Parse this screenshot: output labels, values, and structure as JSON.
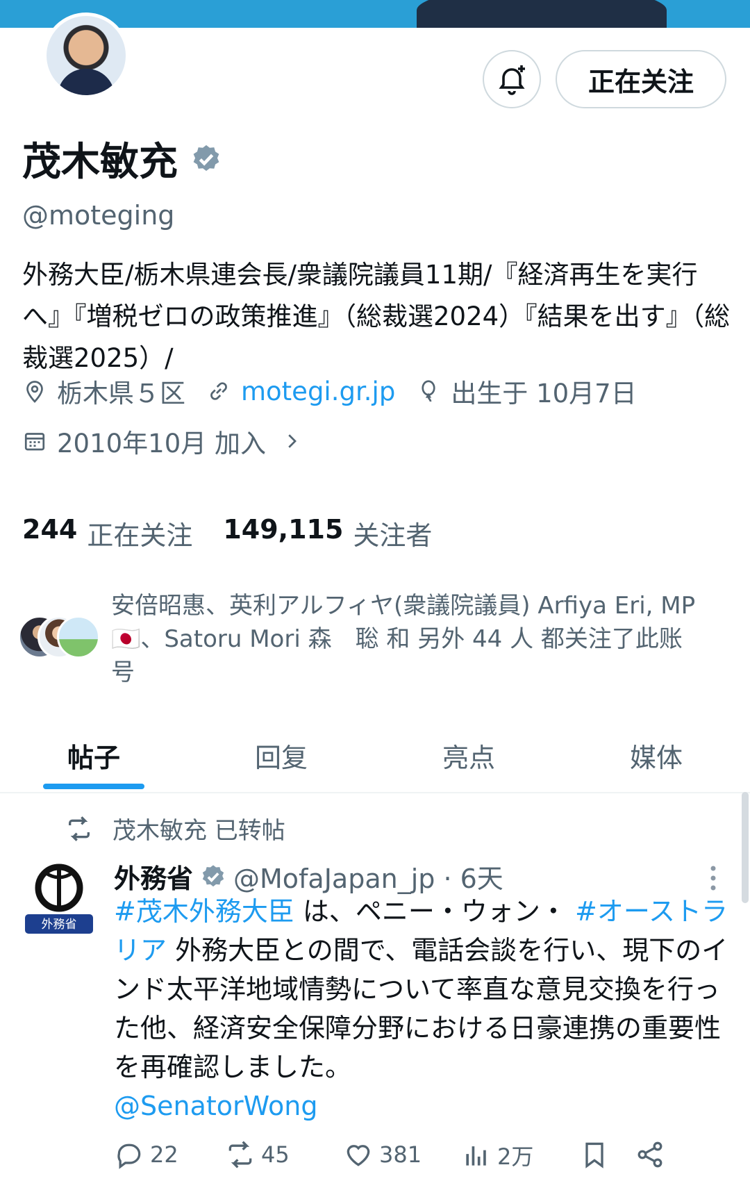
{
  "profile": {
    "name": "茂木敏充",
    "handle": "@moteging",
    "follow_button": "正在关注",
    "bio": "外務大臣/栃木県連会長/衆議院議員11期/『経済再生を実行へ』『増税ゼロの政策推進』（総裁選2024）『結果を出す』（総裁選2025）/",
    "location": "栃木県５区",
    "website": "motegi.gr.jp",
    "birthday": "出生于 10月7日",
    "joined": "2010年10月 加入",
    "following_count": "244",
    "following_label": "正在关注",
    "followers_count": "149,115",
    "followers_label": "关注者",
    "followed_by_line1": "安倍昭惠、英利アルフィヤ(衆議院議員) Arfiya Eri, MP",
    "followed_by_line2": "🇯🇵、Satoru Mori 森　聡 和 另外 44 人 都关注了此账",
    "followed_by_line3": "号"
  },
  "tabs": [
    {
      "label": "帖子"
    },
    {
      "label": "回复"
    },
    {
      "label": "亮点"
    },
    {
      "label": "媒体"
    }
  ],
  "post": {
    "repost_label": "茂木敏充 已转帖",
    "author": "外務省",
    "handle_time": "@MofaJapan_jp · 6天",
    "logo_text": "外務省",
    "text_tag1": "#茂木外務大臣",
    "text_part1": " は、ペニー・ウォン・ ",
    "text_tag2": "#オーストラリア",
    "text_part2": " 外務大臣との間で、電話会談を行い、現下のインド太平洋地域情勢について率直な意見交換を行った他、経済安全保障分野における日豪連携の重要性を再確認しました。",
    "mention": "@SenatorWong",
    "replies": "22",
    "reposts": "45",
    "likes": "381",
    "views": "2万"
  },
  "colors": {
    "accent": "#1d9bf0",
    "secondary_text": "#536471",
    "verified_badge": "#829aab"
  }
}
